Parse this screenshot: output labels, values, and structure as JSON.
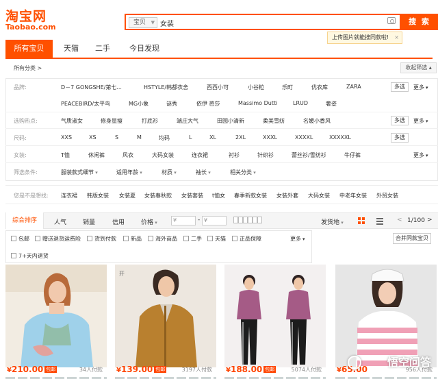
{
  "header": {
    "logo_cn": "淘宝网",
    "logo_en": "Taobao.com",
    "search_type": "宝贝",
    "search_value": "女装",
    "search_button": "搜 索",
    "tip_text": "上传图片就能搜同款啦!",
    "tip_close": "×"
  },
  "tabs": [
    "所有宝贝",
    "天猫",
    "二手",
    "今日发现"
  ],
  "crumb": "所有分类 >",
  "collapse": "收起筛选",
  "filters": {
    "brand": {
      "label": "品牌:",
      "row1": [
        "D－7 GONGSHE/第七...",
        "HSTYLE/韩都衣舍",
        "西西小可",
        "小谷粒",
        "乐町",
        "优衣库",
        "ZARA"
      ],
      "row2": [
        "PEACEBIRD/太平鸟",
        "MG小象",
        "谜秀",
        "依伊 芭莎",
        "Massimo Dutti",
        "LRUD",
        "奢姿"
      ]
    },
    "hot": {
      "label": "选购热点:",
      "items": [
        "气质淑女",
        "修身显瘦",
        "打底衫",
        "端庄大气",
        "田园小清新",
        "柔美雪纺",
        "名媛小香风"
      ]
    },
    "size": {
      "label": "尺码:",
      "items": [
        "XXS",
        "XS",
        "S",
        "M",
        "均码",
        "L",
        "XL",
        "2XL",
        "XXXL",
        "XXXXL",
        "XXXXXL"
      ]
    },
    "cat": {
      "label": "女装:",
      "items": [
        "T恤",
        "休闲裤",
        "风衣",
        "大码女装",
        "连衣裙",
        "衬衫",
        "针织衫",
        "蕾丝衫/雪纺衫",
        "牛仔裤"
      ]
    },
    "cond": {
      "label": "筛选条件:",
      "items": [
        "服装款式细节",
        "适用年龄",
        "材质",
        "袖长",
        "相关分类"
      ]
    },
    "multi": "多选",
    "more": "更多"
  },
  "guess": {
    "label": "您是不是想找:",
    "items": [
      "连衣裙",
      "韩版女装",
      "女装夏",
      "女装春秋款",
      "女装套装",
      "t恤女",
      "春季新款女装",
      "女装外套",
      "大码女装",
      "中老年女装",
      "外贸女装"
    ]
  },
  "sort": {
    "items": [
      "综合排序",
      "人气",
      "销量",
      "信用",
      "价格"
    ],
    "price_min": "¥",
    "price_dash": "-",
    "price_max": "¥",
    "ship_from": "发货地",
    "page": "1/100",
    "prev": "<",
    "next": ">"
  },
  "options": [
    "包邮",
    "赠送退货运费险",
    "货到付款",
    "新品",
    "海外商品",
    "二手",
    "天猫",
    "正品保障",
    "7+天内退货"
  ],
  "options_more": "更多",
  "combine": "合并同款宝贝",
  "products": [
    {
      "price": "210.00",
      "badge": "包邮",
      "sold": "34人付款"
    },
    {
      "price": "139.00",
      "badge": "包邮",
      "sold": "3197人付款"
    },
    {
      "price": "188.00",
      "badge": "包邮",
      "sold": "5074人付款"
    },
    {
      "price": "65.00",
      "badge": "",
      "sold": "956人付款"
    }
  ],
  "currency": "¥",
  "watermark": "悟空问答",
  "colors": {
    "accent": "#ff5000",
    "price": "#ff4400"
  }
}
